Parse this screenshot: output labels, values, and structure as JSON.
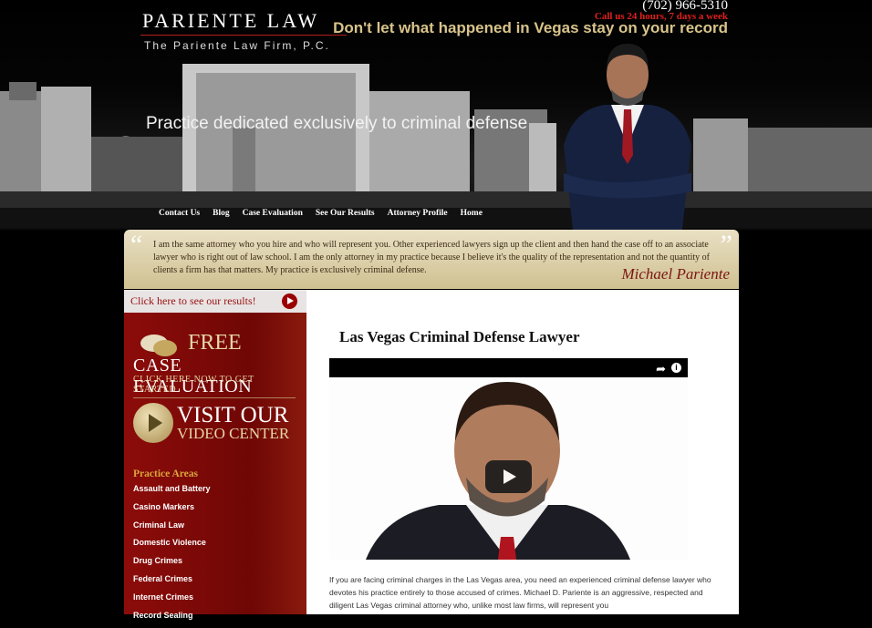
{
  "header": {
    "logo_title": "PARIENTE LAW",
    "logo_subtitle": "The Pariente Law Firm, P.C.",
    "phone": "(702) 966-5310",
    "call_hours": "Call us 24 hours, 7 days a week",
    "tagline": "Don't let what happened in Vegas stay on your record",
    "practice_statement": "Practice dedicated exclusively to criminal defense"
  },
  "nav": {
    "items": [
      "Contact Us",
      "Blog",
      "Case Evaluation",
      "See Our Results",
      "Attorney Profile",
      "Home"
    ]
  },
  "quote": {
    "text": "I am the same attorney who you hire and who will represent you. Other experienced lawyers sign up the client and then hand the case off to an associate lawyer who is right out of law school. I am the only attorney in my practice because I believe it's the quality of the representation and not the quantity of clients a firm has that matters. My practice is exclusively criminal defense.",
    "signature": "Michael Pariente"
  },
  "sidebar": {
    "results_link": "Click here to see our results!",
    "free_label": "FREE",
    "case_eval_label": "CASE EVALUATION",
    "click_here_label": "CLICK HERE NOW TO GET STARTED",
    "visit_label": "VISIT OUR",
    "video_center_label": "VIDEO CENTER",
    "practice_areas_title": "Practice Areas",
    "practice_areas": [
      "Assault and Battery",
      "Casino Markers",
      "Criminal Law",
      "Domestic Violence",
      "Drug Crimes",
      "Federal Crimes",
      "Internet Crimes",
      "Record Sealing"
    ]
  },
  "main": {
    "title": "Las Vegas Criminal Defense Lawyer",
    "body": "If you are facing criminal charges in the Las Vegas area, you need an experienced criminal defense lawyer who devotes his practice entirely to those accused of crimes. Michael D. Pariente is an aggressive, respected and diligent Las Vegas criminal attorney who, unlike most law firms, will represent you"
  },
  "icons": {
    "share": "share-icon",
    "info": "info-icon",
    "play": "play-icon"
  }
}
